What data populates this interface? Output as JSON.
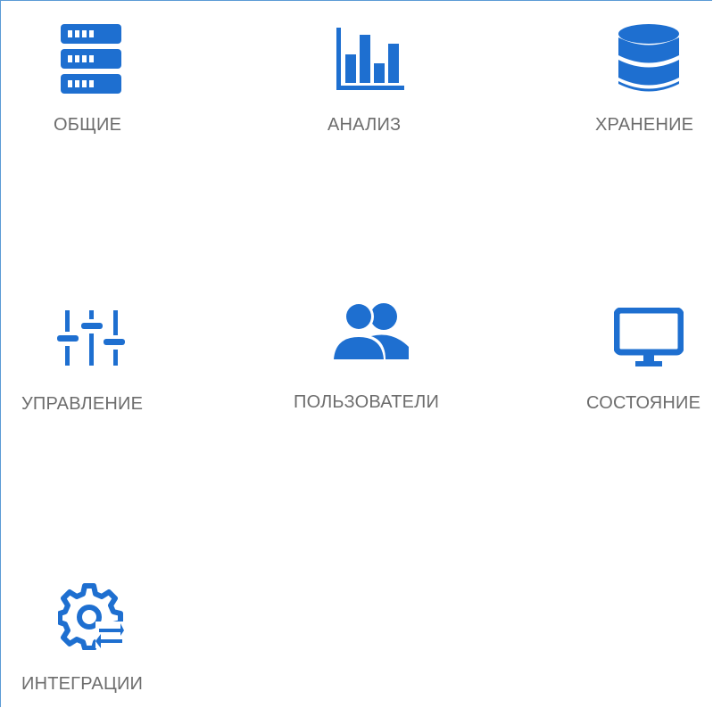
{
  "accent_color": "#1e6fd0",
  "label_color": "#6d6d6d",
  "tiles": [
    {
      "label": "ОБЩИЕ",
      "icon": "server-rack-icon"
    },
    {
      "label": "АНАЛИЗ",
      "icon": "bar-chart-icon"
    },
    {
      "label": "ХРАНЕНИЕ",
      "icon": "database-icon"
    },
    {
      "label": "УПРАВЛЕНИЕ",
      "icon": "sliders-icon"
    },
    {
      "label": "ПОЛЬЗОВАТЕЛИ",
      "icon": "users-icon"
    },
    {
      "label": "СОСТОЯНИЕ",
      "icon": "monitor-icon"
    },
    {
      "label": "ИНТЕГРАЦИИ",
      "icon": "gear-sync-icon"
    }
  ]
}
